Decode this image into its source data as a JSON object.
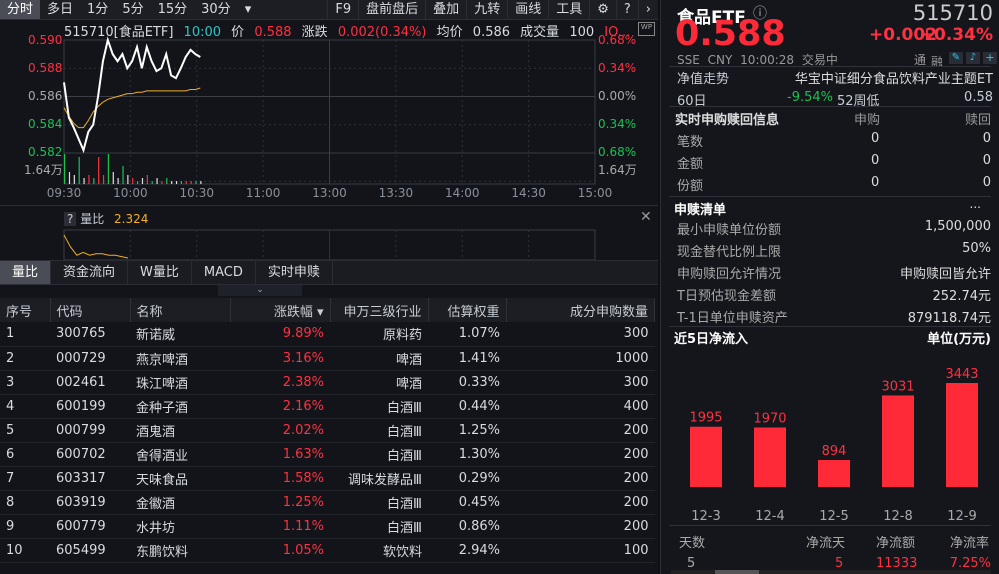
{
  "toolbar": {
    "tabs": [
      "分时",
      "多日",
      "1分",
      "5分",
      "15分",
      "30分"
    ],
    "right": [
      "F9",
      "盘前盘后",
      "叠加",
      "九转",
      "画线",
      "工具"
    ],
    "dropdown": "▾"
  },
  "header": {
    "code_name": "515710[食品ETF]",
    "time": "10:00",
    "price_label": "价",
    "price": "0.588",
    "change_label": "涨跌",
    "change": "0.002(0.34%)",
    "avg_label": "均价",
    "avg": "0.586",
    "vol_label": "成交量",
    "vol": "100",
    "more": "IO..."
  },
  "chart_data": {
    "type": "line",
    "title": "515710 分时",
    "y_ticks_left": [
      "0.590",
      "0.588",
      "0.586",
      "0.584",
      "0.582"
    ],
    "y_ticks_right": [
      "0.68%",
      "0.34%",
      "0.00%",
      "0.34%",
      "0.68%"
    ],
    "ylim": [
      0.582,
      0.59
    ],
    "vol_label": "1.64万",
    "x_ticks": [
      "09:30",
      "10:00",
      "10:30",
      "11:00",
      "13:00",
      "13:30",
      "14:00",
      "14:30",
      "15:00"
    ],
    "price": [
      0.587,
      0.5845,
      0.5838,
      0.583,
      0.5822,
      0.5835,
      0.584,
      0.586,
      0.5885,
      0.59,
      0.589,
      0.5885,
      0.589,
      0.588,
      0.5885,
      0.5895,
      0.588,
      0.5895,
      0.5885,
      0.5878,
      0.588,
      0.589,
      0.5875,
      0.5873,
      0.588,
      0.5888,
      0.5893,
      0.589,
      0.5888
    ],
    "avg": [
      0.5852,
      0.5846,
      0.5841,
      0.5838,
      0.5838,
      0.5843,
      0.5849,
      0.5853,
      0.5856,
      0.5858,
      0.5859,
      0.586,
      0.5861,
      0.5862,
      0.5862,
      0.5863,
      0.5863,
      0.5864,
      0.5864,
      0.5864,
      0.5864,
      0.5864,
      0.5864,
      0.5864,
      0.5864,
      0.5864,
      0.5865,
      0.5865,
      0.5866
    ],
    "volume": [
      1.0,
      0.4,
      0.3,
      0.9,
      0.2,
      0.3,
      0.2,
      0.9,
      0.3,
      1.0,
      0.4,
      0.2,
      0.6,
      0.3,
      0.2,
      0.1,
      0.2,
      0.3,
      0.1,
      0.2,
      0.1,
      0.2,
      0.1,
      0.1,
      0.1,
      0.1,
      0.1,
      0.1,
      0.1
    ]
  },
  "sub": {
    "help": "?",
    "label": "量比",
    "value": "2.324",
    "series": [
      2.324,
      1.9,
      1.6,
      1.7,
      1.6,
      1.65,
      1.65,
      1.6,
      1.6,
      1.55,
      1.5
    ]
  },
  "bottom_tabs": [
    "量比",
    "资金流向",
    "W量比",
    "MACD",
    "实时申赎"
  ],
  "table": {
    "headers": [
      "序号",
      "代码",
      "名称",
      "涨跌幅 ▾",
      "申万三级行业",
      "估算权重",
      "成分申购数量"
    ],
    "rows": [
      [
        "1",
        "300765",
        "新诺威",
        "9.89%",
        "原料药",
        "1.07%",
        "300"
      ],
      [
        "2",
        "000729",
        "燕京啤酒",
        "3.16%",
        "啤酒",
        "1.41%",
        "1000"
      ],
      [
        "3",
        "002461",
        "珠江啤酒",
        "2.38%",
        "啤酒",
        "0.33%",
        "300"
      ],
      [
        "4",
        "600199",
        "金种子酒",
        "2.16%",
        "白酒Ⅲ",
        "0.44%",
        "400"
      ],
      [
        "5",
        "000799",
        "酒鬼酒",
        "2.02%",
        "白酒Ⅲ",
        "1.25%",
        "200"
      ],
      [
        "6",
        "600702",
        "舍得酒业",
        "1.63%",
        "白酒Ⅲ",
        "1.30%",
        "200"
      ],
      [
        "7",
        "603317",
        "天味食品",
        "1.58%",
        "调味发酵品Ⅲ",
        "0.29%",
        "200"
      ],
      [
        "8",
        "603919",
        "金徽酒",
        "1.25%",
        "白酒Ⅲ",
        "0.45%",
        "200"
      ],
      [
        "9",
        "600779",
        "水井坊",
        "1.11%",
        "白酒Ⅲ",
        "0.86%",
        "200"
      ],
      [
        "10",
        "605499",
        "东鹏饮料",
        "1.05%",
        "软饮料",
        "2.94%",
        "100"
      ]
    ]
  },
  "quote": {
    "name": "食品ETF",
    "code": "515710",
    "price": "0.588",
    "change": "+0.002",
    "pct": "+0.34%",
    "exchange": "SSE",
    "currency": "CNY",
    "time": "10:00:28",
    "status": "交易中",
    "tong": "通",
    "rong": "融"
  },
  "nav": {
    "label": "净值走势",
    "fullname": "华宝中证细分食品饮料产业主题ET",
    "p60_label": "60日",
    "p60": "-9.54%",
    "low52_label": "52周低",
    "low52": "0.58"
  },
  "rt": {
    "title": "实时申购赎回信息",
    "sub": "申购",
    "red": "赎回",
    "rows": [
      [
        "笔数",
        "0",
        "0"
      ],
      [
        "金额",
        "0",
        "0"
      ],
      [
        "份额",
        "0",
        "0"
      ]
    ]
  },
  "list": {
    "title": "申赎清单",
    "more": "...",
    "rows": [
      [
        "最小申赎单位份额",
        "1,500,000"
      ],
      [
        "现金替代比例上限",
        "50%"
      ],
      [
        "申购赎回允许情况",
        "申购赎回皆允许"
      ],
      [
        "T日预估现金差额",
        "252.74元"
      ],
      [
        "T-1日单位申赎资产",
        "879118.74元"
      ]
    ]
  },
  "flow": {
    "title": "近5日净流入",
    "unit": "单位(万元)",
    "categories": [
      "12-3",
      "12-4",
      "12-5",
      "12-8",
      "12-9"
    ],
    "values": [
      1995,
      1970,
      894,
      3031,
      3443
    ],
    "labels": [
      "1995",
      "1970",
      "894",
      "3031",
      "3443"
    ],
    "stats_headers": [
      "天数",
      "净流天",
      "净流额",
      "净流率"
    ],
    "stats": [
      "5",
      "5",
      "11333",
      "7.25%"
    ]
  }
}
